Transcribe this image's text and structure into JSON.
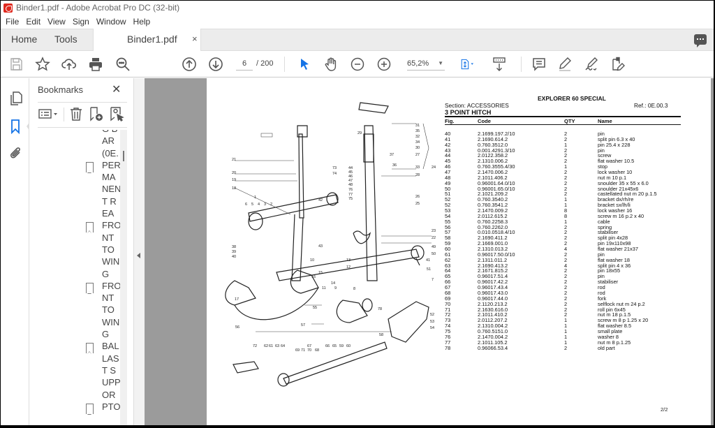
{
  "window": {
    "title": "Binder1.pdf - Adobe Acrobat Pro DC (32-bit)"
  },
  "menu": [
    "File",
    "Edit",
    "View",
    "Sign",
    "Window",
    "Help"
  ],
  "tabs": {
    "home": "Home",
    "tools": "Tools",
    "document": "Binder1.pdf",
    "close": "×"
  },
  "toolbar": {
    "icons": [
      "save-icon",
      "bookmark-star-icon",
      "cloud-upload-icon",
      "print-icon",
      "search-zoom-icon",
      "previous-page-icon",
      "next-page-icon",
      "select-arrow-icon",
      "hand-icon",
      "zoom-out-icon",
      "zoom-in-icon",
      "fit-page-icon",
      "scroll-mode-icon",
      "comment-icon",
      "highlight-icon",
      "sign-icon",
      "fill-sign-icon"
    ],
    "current_page": "6",
    "total_pages": "/ 200",
    "zoom": "65,2%"
  },
  "sidebar": {
    "rail_icons": [
      "page-thumbnails-icon",
      "bookmarks-icon",
      "attachments-icon"
    ],
    "active": "bookmarks",
    "accent": "#1473e6"
  },
  "bookmarks": {
    "title": "Bookmarks",
    "close": "✕",
    "tools": [
      "options-icon",
      "delete-icon",
      "new-bookmark-icon",
      "bookmark-properties-icon"
    ],
    "items": [
      {
        "label": "G BAR (0E.",
        "flag": false
      },
      {
        "label": "PERMANENT REA",
        "flag": true
      },
      {
        "label": "FRONT TO WING",
        "flag": true
      },
      {
        "label": "FRONT TO WING",
        "flag": true
      },
      {
        "label": "BALLAST SUPPOR",
        "flag": true
      },
      {
        "label": "PTO",
        "flag": true
      }
    ]
  },
  "document": {
    "model": "EXPLORER 60 SPECIAL",
    "section": "Section: ACCESSORIES",
    "ref": "Ref.: 0E.00.3",
    "heading": "3 POINT HITCH",
    "columns": [
      "Fig.",
      "Code",
      "QTY",
      "Name"
    ],
    "rows": [
      [
        "40",
        "2.1699.197.2/10",
        "2",
        "pin"
      ],
      [
        "41",
        "2.1690.614.2",
        "2",
        "split pin 6.3 x 40"
      ],
      [
        "42",
        "0.760.3512.0",
        "1",
        "pin 25.4 x 228"
      ],
      [
        "43",
        "0.001.4291.3/10",
        "2",
        "pin"
      ],
      [
        "44",
        "2.0122.358.2",
        "2",
        "screw"
      ],
      [
        "45",
        "2.1310.006.2",
        "2",
        "flat washer 10.5"
      ],
      [
        "46",
        "0.760.3555.4/30",
        "1",
        "stop"
      ],
      [
        "47",
        "2.1470.006.2",
        "2",
        "lock washer 10"
      ],
      [
        "48",
        "2.1011.406.2",
        "2",
        "nut m 10 p.1"
      ],
      [
        "49",
        "0.96001.64.0/10",
        "2",
        "snoulder 35 x 55 x 6.0"
      ],
      [
        "50",
        "0.96001.65.0/10",
        "2",
        "snoulder 21x45x6"
      ],
      [
        "51",
        "2.1021.209.2",
        "2",
        "castellated nut m 20 p.1.5"
      ],
      [
        "52",
        "0.760.3540.2",
        "1",
        "bracket dx/rh/re"
      ],
      [
        "52",
        "0.760.3541.2",
        "1",
        "bracket sx/lh/li"
      ],
      [
        "53",
        "2.1470.009.2",
        "8",
        "lock washer 16"
      ],
      [
        "54",
        "2.0112.615.2",
        "8",
        "screw m 16 p.2 x 40"
      ],
      [
        "55",
        "0.760.2258.3",
        "1",
        "cable"
      ],
      [
        "56",
        "0.760.2262.0",
        "2",
        "spring"
      ],
      [
        "57",
        "0.010.0518.4/10",
        "2",
        "stabiliser"
      ],
      [
        "58",
        "2.1690.411.2",
        "2",
        "split pin 4x28"
      ],
      [
        "59",
        "2.1669.001.0",
        "2",
        "pin 19x110x98"
      ],
      [
        "60",
        "2.1310.013.2",
        "4",
        "flat washer 21x37"
      ],
      [
        "61",
        "0.96017.50.0/10",
        "2",
        "pin"
      ],
      [
        "62",
        "2.1311.011.2",
        "2",
        "flat washer 18"
      ],
      [
        "63",
        "2.1690.413.2",
        "4",
        "split pin 4 x 36"
      ],
      [
        "64",
        "2.1671.815.2",
        "2",
        "pin 18x55"
      ],
      [
        "65",
        "0.96017.51.4",
        "2",
        "pin"
      ],
      [
        "66",
        "0.96017.42.2",
        "2",
        "stabiliser"
      ],
      [
        "67",
        "0.96017.43.4",
        "2",
        "rod"
      ],
      [
        "68",
        "0.96017.43.0",
        "2",
        "rod"
      ],
      [
        "69",
        "0.96017.44.0",
        "2",
        "fork"
      ],
      [
        "70",
        "2.1120.213.2",
        "2",
        "selflock nut m 24 p.2"
      ],
      [
        "71",
        "2.1630.616.0",
        "2",
        "roll pin 6x45"
      ],
      [
        "72",
        "2.1011.410.2",
        "2",
        "nut m 18 p.1.5"
      ],
      [
        "73",
        "2.0112.207.2",
        "1",
        "screw m 8 p 1.25 x 20"
      ],
      [
        "74",
        "2.1310.004.2",
        "1",
        "flat washer 8.5"
      ],
      [
        "75",
        "0.760.5151.0",
        "1",
        "small plate"
      ],
      [
        "76",
        "2.1470.004.2",
        "1",
        "washer 8"
      ],
      [
        "77",
        "2.1011.105.2",
        "1",
        "nut m 8 p.1.25"
      ],
      [
        "78",
        "0.96066.53.4",
        "2",
        "old part"
      ]
    ],
    "page_number": "2/2",
    "diagram_labels": [
      "31",
      "35",
      "32",
      "34",
      "30",
      "37",
      "27",
      "36",
      "33",
      "28",
      "26",
      "25",
      "24",
      "29",
      "21",
      "20",
      "19",
      "18",
      "1",
      "6",
      "5",
      "4",
      "3",
      "2",
      "42",
      "73",
      "74",
      "44",
      "45",
      "46",
      "47",
      "48",
      "76",
      "77",
      "75",
      "43",
      "23",
      "22",
      "49",
      "50",
      "41",
      "51",
      "7",
      "38",
      "39",
      "40",
      "10",
      "13",
      "12",
      "15",
      "16",
      "14",
      "11",
      "9",
      "8",
      "17",
      "55",
      "56",
      "78",
      "52",
      "53",
      "54",
      "57",
      "58",
      "72",
      "62",
      "61",
      "63",
      "64",
      "67",
      "69",
      "71",
      "70",
      "68",
      "66",
      "65",
      "59",
      "60"
    ]
  }
}
